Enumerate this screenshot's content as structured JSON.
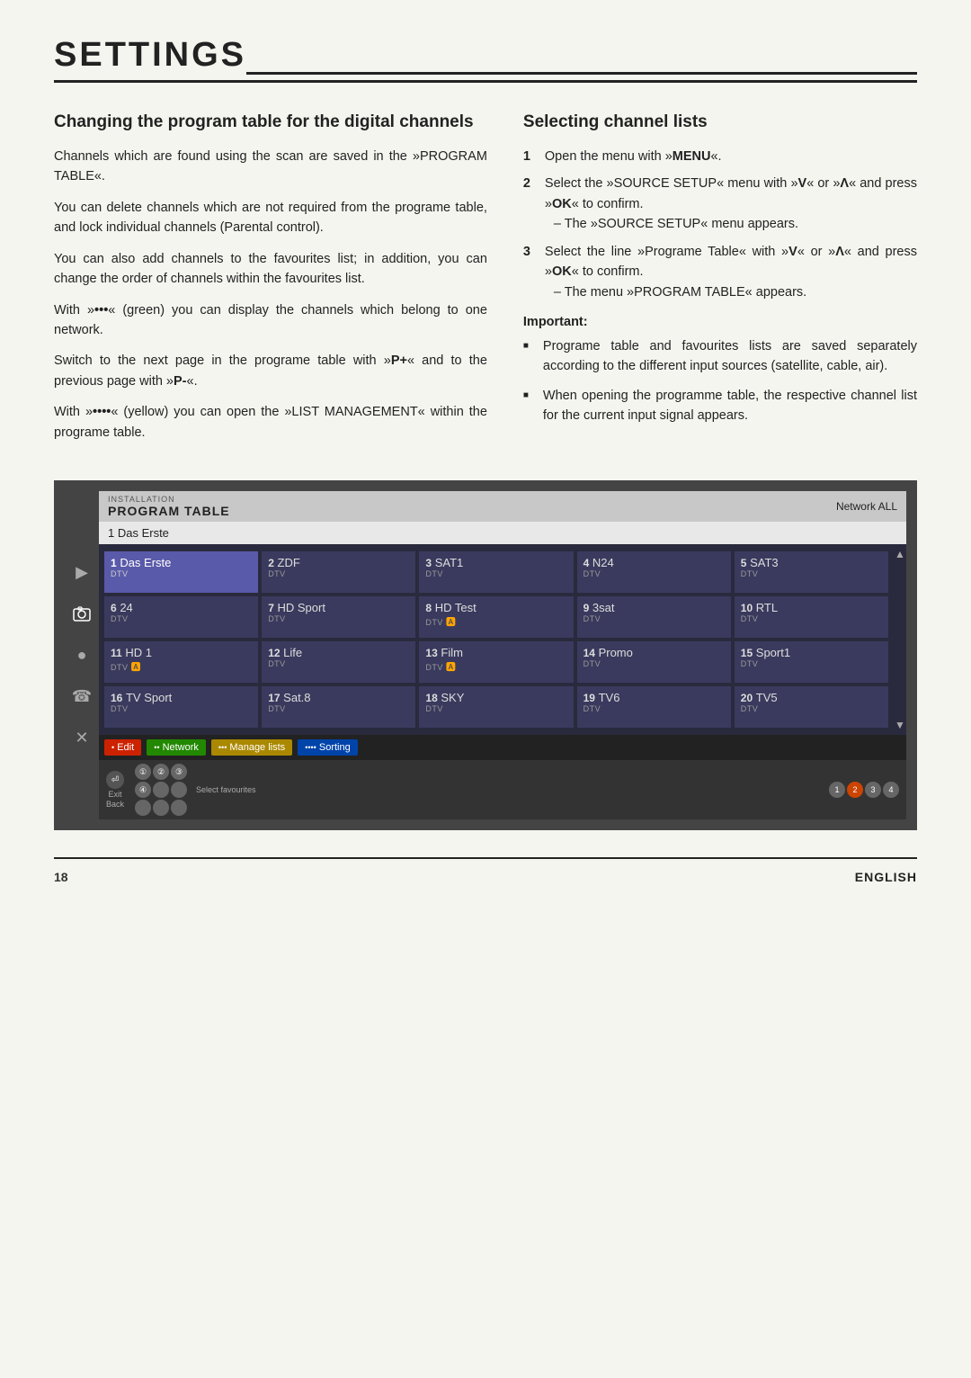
{
  "page": {
    "title": "SETTINGS",
    "page_number": "18",
    "language": "ENGLISH"
  },
  "left_section": {
    "title": "Changing the program table for the digital channels",
    "paragraphs": [
      "Channels which are found using the scan are saved in the »PROGRAM TABLE«.",
      "You can delete channels which are not required from the programe table, and lock individual channels (Parental control).",
      "You can also add channels to the favourites list; in addition, you can change the order of channels within the favourites list.",
      "With »•••« (green) you can display the channels which belong to one network.",
      "Switch to the next page in the programe table with »P+« and to the previous page with »P-«.",
      "With »••••« (yellow) you can open the »LIST MANAGEMENT« within the programe table."
    ]
  },
  "right_section": {
    "title": "Selecting channel lists",
    "steps": [
      {
        "num": "1",
        "text": "Open the menu with »MENU«."
      },
      {
        "num": "2",
        "text": "Select the »SOURCE SETUP« menu with »V« or »Λ« and press »OK« to confirm.",
        "sub": "– The »SOURCE SETUP« menu appears."
      },
      {
        "num": "3",
        "text": "Select the line »Programe Table« with »V« or »Λ« and press »OK« to confirm.",
        "sub": "– The menu »PROGRAM TABLE« appears."
      }
    ],
    "important_label": "Important:",
    "important_bullets": [
      "Programe table and favourites lists are saved separately according to the different input sources (satellite, cable, air).",
      "When opening the programme table, the respective channel list for the current input signal appears."
    ]
  },
  "tv_ui": {
    "installation_label": "INSTALLATION",
    "program_table_label": "PROGRAM TABLE",
    "network_label": "Network ALL",
    "selected_channel": "1   Das Erste",
    "channels": [
      {
        "num": "1",
        "name": "Das Erste",
        "type": "DTV",
        "selected": true,
        "ca": false
      },
      {
        "num": "2",
        "name": "ZDF",
        "type": "DTV",
        "selected": false,
        "ca": false
      },
      {
        "num": "3",
        "name": "SAT1",
        "type": "DTV",
        "selected": false,
        "ca": false
      },
      {
        "num": "4",
        "name": "N24",
        "type": "DTV",
        "selected": false,
        "ca": false
      },
      {
        "num": "5",
        "name": "SAT3",
        "type": "DTV",
        "selected": false,
        "ca": false
      },
      {
        "num": "6",
        "name": "24",
        "type": "DTV",
        "selected": false,
        "ca": false
      },
      {
        "num": "7",
        "name": "HD Sport",
        "type": "DTV",
        "selected": false,
        "ca": false
      },
      {
        "num": "8",
        "name": "HD Test",
        "type": "DTV",
        "selected": false,
        "ca": true
      },
      {
        "num": "9",
        "name": "3sat",
        "type": "DTV",
        "selected": false,
        "ca": false
      },
      {
        "num": "10",
        "name": "RTL",
        "type": "DTV",
        "selected": false,
        "ca": false
      },
      {
        "num": "11",
        "name": "HD 1",
        "type": "DTV",
        "selected": false,
        "ca": true
      },
      {
        "num": "12",
        "name": "Life",
        "type": "DTV",
        "selected": false,
        "ca": false
      },
      {
        "num": "13",
        "name": "Film",
        "type": "DTV",
        "selected": false,
        "ca": true
      },
      {
        "num": "14",
        "name": "Promo",
        "type": "DTV",
        "selected": false,
        "ca": false
      },
      {
        "num": "15",
        "name": "Sport1",
        "type": "DTV",
        "selected": false,
        "ca": false
      },
      {
        "num": "16",
        "name": "TV Sport",
        "type": "DTV",
        "selected": false,
        "ca": false
      },
      {
        "num": "17",
        "name": "Sat.8",
        "type": "DTV",
        "selected": false,
        "ca": false
      },
      {
        "num": "18",
        "name": "SKY",
        "type": "DTV",
        "selected": false,
        "ca": false
      },
      {
        "num": "19",
        "name": "TV6",
        "type": "DTV",
        "selected": false,
        "ca": false
      },
      {
        "num": "20",
        "name": "TV5",
        "type": "DTV",
        "selected": false,
        "ca": false
      }
    ],
    "buttons": [
      {
        "color": "red",
        "label": "Edit"
      },
      {
        "color": "green",
        "label": "Network"
      },
      {
        "color": "yellow",
        "label": "Manage lists"
      },
      {
        "color": "blue",
        "label": "Sorting"
      }
    ],
    "footer": {
      "exit_label": "Exit",
      "back_label": "Back",
      "select_favourites": "Select favourites",
      "fav_rows": [
        [
          "①",
          "②",
          "③"
        ],
        [
          "④",
          "○",
          "○"
        ],
        [
          "○",
          "○",
          "○"
        ]
      ],
      "page_numbers": [
        "1",
        "2",
        "3",
        "4"
      ],
      "active_page": "2"
    },
    "sidebar_icons": [
      "play-icon",
      "camera-icon",
      "circle-icon",
      "phone-icon",
      "tool-icon"
    ]
  }
}
